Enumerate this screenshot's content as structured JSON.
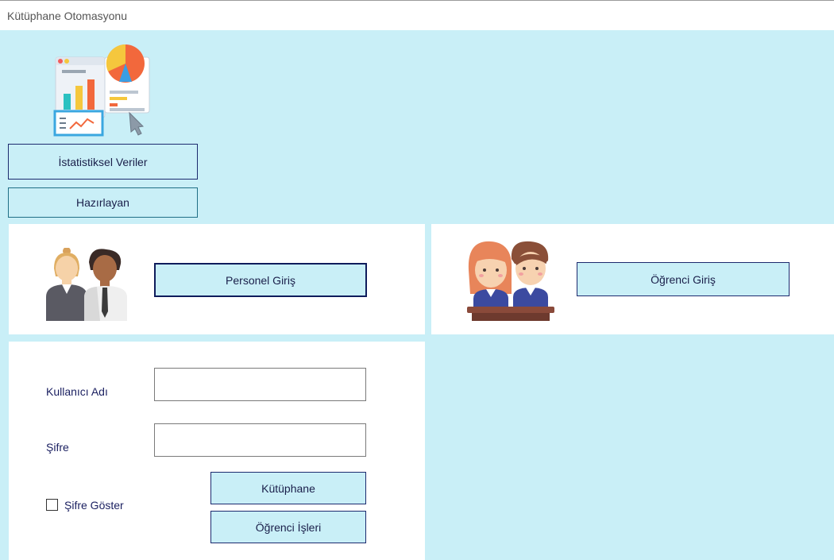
{
  "window": {
    "title": "Kütüphane Otomasyonu"
  },
  "top": {
    "stats_icon": "statistics-report-icon",
    "stats_button": "İstatistiksel Veriler",
    "author_button": "Hazırlayan"
  },
  "staff": {
    "icon": "staff-people-icon",
    "login_button": "Personel Giriş"
  },
  "student": {
    "icon": "students-icon",
    "login_button": "Öğrenci Giriş"
  },
  "login_form": {
    "username_label": "Kullanıcı Adı",
    "username_value": "",
    "password_label": "Şifre",
    "password_value": "",
    "show_password_label": "Şifre Göster",
    "show_password_checked": false,
    "library_button": "Kütüphane",
    "student_affairs_button": "Öğrenci İşleri"
  },
  "colors": {
    "background": "#c9eff7",
    "panel": "#ffffff",
    "button_border": "#1c2a6e",
    "text": "#1a1f4a"
  }
}
